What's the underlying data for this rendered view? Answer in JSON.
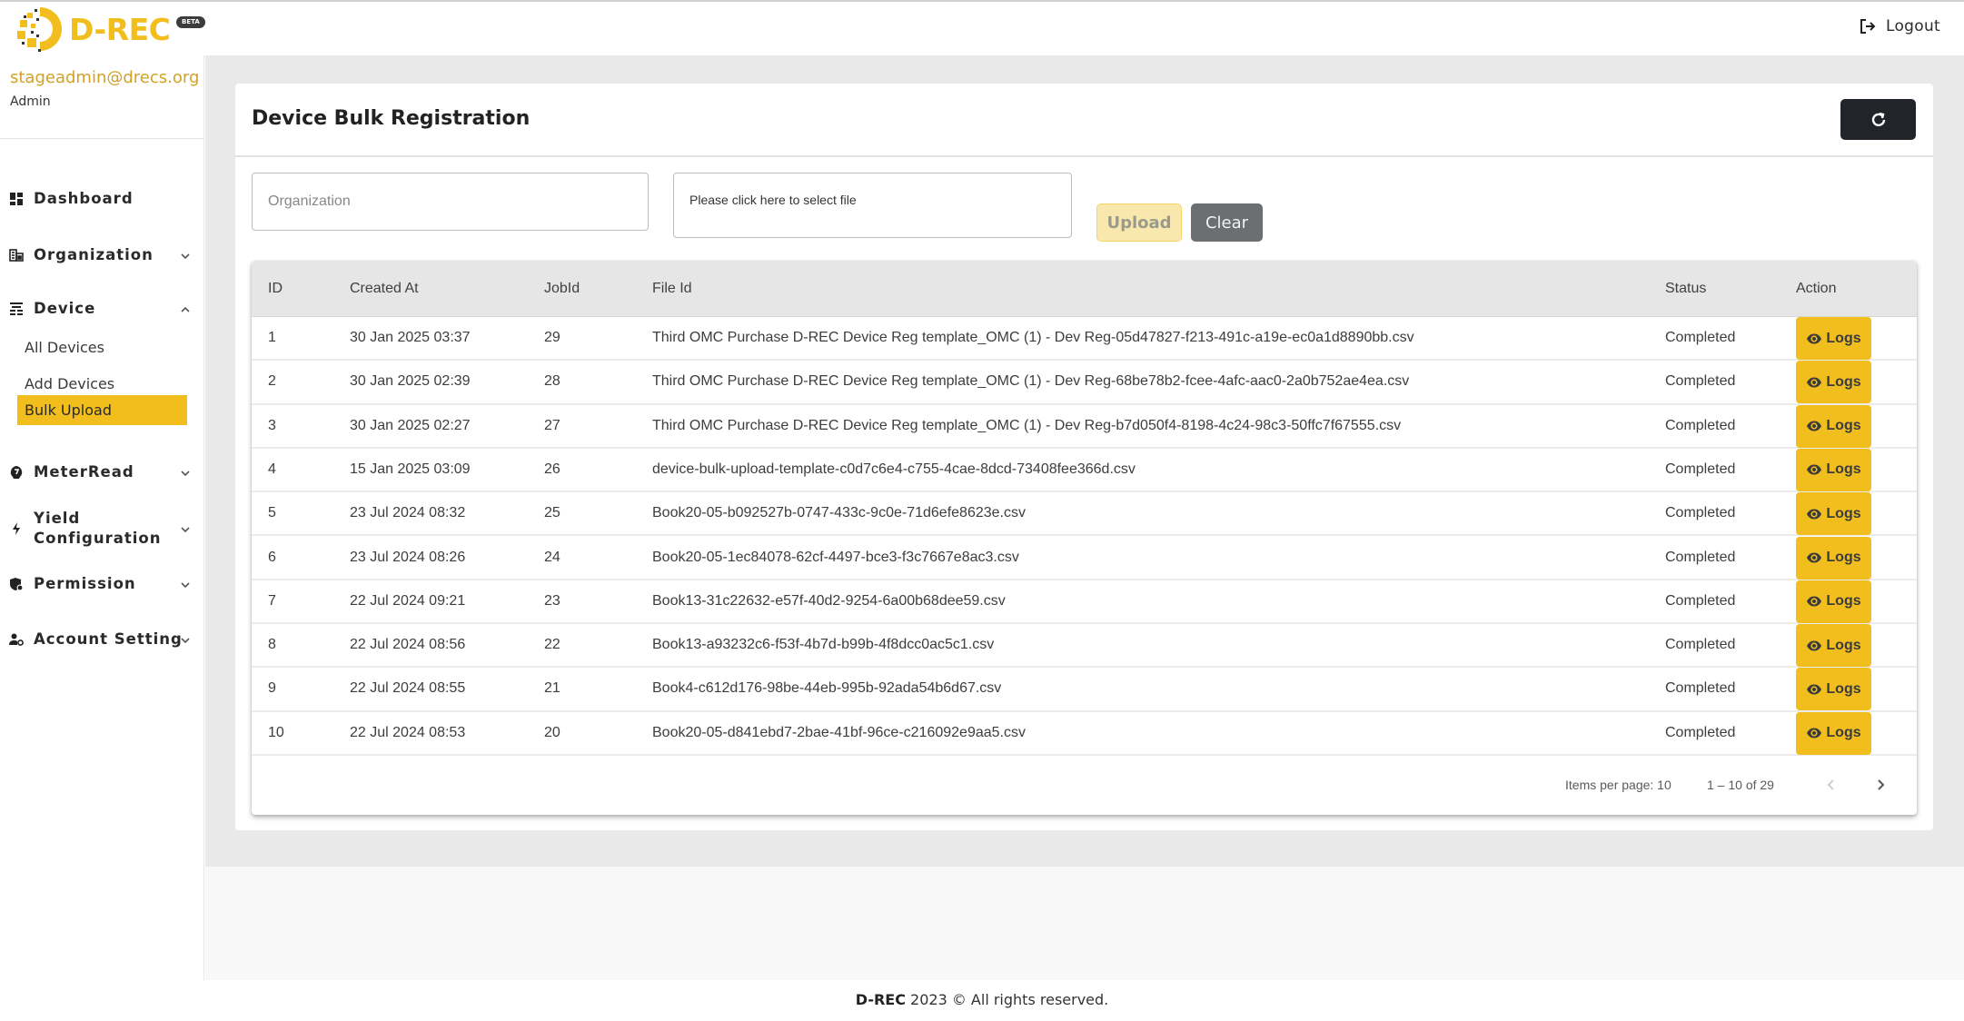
{
  "brand": {
    "name": "D-REC",
    "badge": "BETA",
    "accent": "#f1be1e"
  },
  "header": {
    "logout_label": "Logout"
  },
  "user": {
    "email": "stageadmin@drecs.org",
    "role": "Admin"
  },
  "sidebar": {
    "items": [
      {
        "label": "Dashboard",
        "icon": "dashboard-icon",
        "expandable": false
      },
      {
        "label": "Organization",
        "icon": "building-icon",
        "expandable": true,
        "expanded": false
      },
      {
        "label": "Device",
        "icon": "device-icon",
        "expandable": true,
        "expanded": true,
        "children": [
          {
            "label": "All Devices",
            "active": false
          },
          {
            "label": "Add Devices",
            "active": false
          },
          {
            "label": "Bulk Upload",
            "active": true
          }
        ]
      },
      {
        "label": "MeterRead",
        "icon": "meter-icon",
        "expandable": true,
        "expanded": false
      },
      {
        "label": "Yield Configuration",
        "label_line1": "Yield",
        "label_line2": "Configuration",
        "icon": "bolt-icon",
        "expandable": true,
        "expanded": false
      },
      {
        "label": "Permission",
        "icon": "shield-icon",
        "expandable": true,
        "expanded": false
      },
      {
        "label": "Account Setting",
        "icon": "user-gear-icon",
        "expandable": true,
        "expanded": false
      }
    ]
  },
  "page": {
    "title": "Device Bulk Registration",
    "organization_placeholder": "Organization",
    "organization_value": "",
    "file_placeholder": "Please click here to select file",
    "upload_label": "Upload",
    "clear_label": "Clear"
  },
  "table": {
    "columns": [
      "ID",
      "Created At",
      "JobId",
      "File Id",
      "Status",
      "Action"
    ],
    "action_label": "Logs",
    "rows": [
      {
        "id": "1",
        "created_at": "30 Jan 2025 03:37",
        "job_id": "29",
        "file_id": "Third OMC Purchase D-REC Device Reg template_OMC (1) - Dev Reg-05d47827-f213-491c-a19e-ec0a1d8890bb.csv",
        "status": "Completed"
      },
      {
        "id": "2",
        "created_at": "30 Jan 2025 02:39",
        "job_id": "28",
        "file_id": "Third OMC Purchase D-REC Device Reg template_OMC (1) - Dev Reg-68be78b2-fcee-4afc-aac0-2a0b752ae4ea.csv",
        "status": "Completed"
      },
      {
        "id": "3",
        "created_at": "30 Jan 2025 02:27",
        "job_id": "27",
        "file_id": "Third OMC Purchase D-REC Device Reg template_OMC (1) - Dev Reg-b7d050f4-8198-4c24-98c3-50ffc7f67555.csv",
        "status": "Completed"
      },
      {
        "id": "4",
        "created_at": "15 Jan 2025 03:09",
        "job_id": "26",
        "file_id": "device-bulk-upload-template-c0d7c6e4-c755-4cae-8dcd-73408fee366d.csv",
        "status": "Completed"
      },
      {
        "id": "5",
        "created_at": "23 Jul 2024 08:32",
        "job_id": "25",
        "file_id": "Book20-05-b092527b-0747-433c-9c0e-71d6efe8623e.csv",
        "status": "Completed"
      },
      {
        "id": "6",
        "created_at": "23 Jul 2024 08:26",
        "job_id": "24",
        "file_id": "Book20-05-1ec84078-62cf-4497-bce3-f3c7667e8ac3.csv",
        "status": "Completed"
      },
      {
        "id": "7",
        "created_at": "22 Jul 2024 09:21",
        "job_id": "23",
        "file_id": "Book13-31c22632-e57f-40d2-9254-6a00b68dee59.csv",
        "status": "Completed"
      },
      {
        "id": "8",
        "created_at": "22 Jul 2024 08:56",
        "job_id": "22",
        "file_id": "Book13-a93232c6-f53f-4b7d-b99b-4f8dcc0ac5c1.csv",
        "status": "Completed"
      },
      {
        "id": "9",
        "created_at": "22 Jul 2024 08:55",
        "job_id": "21",
        "file_id": "Book4-c612d176-98be-44eb-995b-92ada54b6d67.csv",
        "status": "Completed"
      },
      {
        "id": "10",
        "created_at": "22 Jul 2024 08:53",
        "job_id": "20",
        "file_id": "Book20-05-d841ebd7-2bae-41bf-96ce-c216092e9aa5.csv",
        "status": "Completed"
      }
    ]
  },
  "paginator": {
    "items_per_page_label": "Items per page: 10",
    "range_label": "1 – 10 of 29",
    "prev_disabled": true,
    "next_disabled": false
  },
  "footer": {
    "brand": "D-REC",
    "text": " 2023 © All rights reserved."
  }
}
